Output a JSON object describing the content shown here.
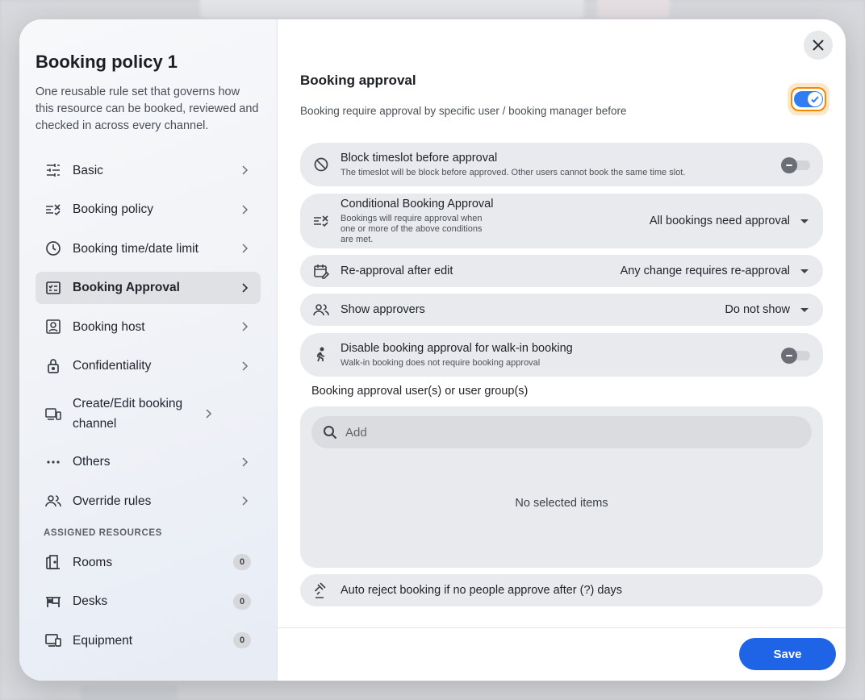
{
  "sidebar": {
    "title": "Booking policy 1",
    "description": "One reusable rule set that governs how this resource can be booked, reviewed and checked in across every channel.",
    "items": [
      {
        "label": "Basic",
        "icon": "sliders-icon"
      },
      {
        "label": "Booking policy",
        "icon": "checklist-icon"
      },
      {
        "label": "Booking time/date limit",
        "icon": "clock-icon"
      },
      {
        "label": "Booking Approval",
        "icon": "approval-icon",
        "active": true
      },
      {
        "label": "Booking host",
        "icon": "host-icon"
      },
      {
        "label": "Confidentiality",
        "icon": "lock-icon"
      },
      {
        "label": "Create/Edit booking channel",
        "icon": "devices-icon"
      },
      {
        "label": "Others",
        "icon": "more-icon"
      },
      {
        "label": "Override rules",
        "icon": "users-icon"
      }
    ],
    "section_label": "ASSIGNED RESOURCES",
    "resources": [
      {
        "label": "Rooms",
        "count": "0",
        "icon": "door-icon"
      },
      {
        "label": "Desks",
        "count": "0",
        "icon": "desk-icon"
      },
      {
        "label": "Equipment",
        "count": "0",
        "icon": "equipment-icon"
      }
    ]
  },
  "main": {
    "heading": "Booking approval",
    "heading_desc": "Booking require approval by specific user / booking manager before",
    "toggle_on": true,
    "rows": {
      "block_timeslot": {
        "title": "Block timeslot before approval",
        "sub": "The timeslot will be block before approved. Other users cannot book the same time slot."
      },
      "conditional": {
        "title": "Conditional Booking Approval",
        "sub": "Bookings will require approval when one or more of the above conditions are met.",
        "value": "All bookings need approval"
      },
      "reapproval": {
        "title": "Re-approval after edit",
        "value": "Any change requires re-approval"
      },
      "approvers": {
        "title": "Show approvers",
        "value": "Do not show"
      },
      "walkin": {
        "title": "Disable booking approval for walk-in booking",
        "sub": "Walk-in booking does not require booking approval"
      },
      "auto_reject": {
        "title": "Auto reject booking if no people approve after (?) days"
      }
    },
    "users_label": "Booking approval user(s) or user group(s)",
    "search_placeholder": "Add",
    "empty_text": "No selected items",
    "save_label": "Save"
  },
  "colors": {
    "accent": "#1f63e6",
    "toggle_on": "#2f7df0",
    "focus_ring": "#f08a00"
  }
}
